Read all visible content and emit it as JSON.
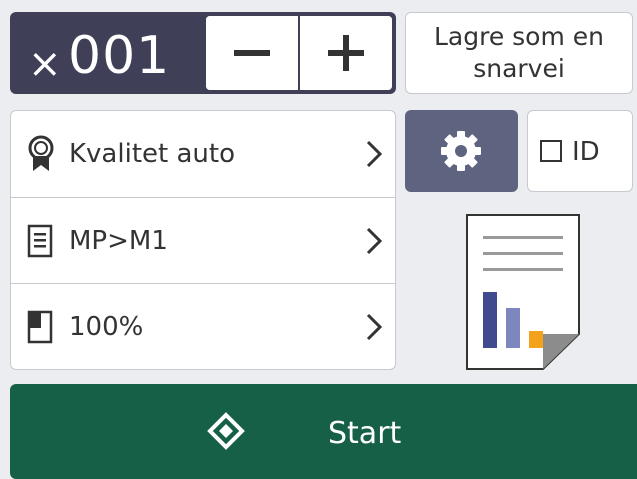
{
  "copies": {
    "prefix": "×",
    "count": "001",
    "minus_icon": "minus-icon",
    "plus_icon": "plus-icon"
  },
  "shortcut_button": {
    "line1": "Lagre som en",
    "line2": "snarvei"
  },
  "settings": {
    "items": [
      {
        "icon": "quality-ribbon-icon",
        "label": "Kvalitet auto"
      },
      {
        "icon": "tray-list-icon",
        "label": "MP>M1"
      },
      {
        "icon": "page-scale-icon",
        "label": "100%"
      }
    ]
  },
  "options_button": {
    "icon": "gear-icon"
  },
  "id_toggle": {
    "label": "ID",
    "checked": false
  },
  "preview": {
    "icon": "document-preview-icon"
  },
  "start_button": {
    "label": "Start",
    "icon": "start-diamond-icon"
  },
  "colors": {
    "header_bg": "#3f3f57",
    "gear_bg": "#5e647f",
    "start_bg": "#176048",
    "screen_bg": "#ecedf0"
  }
}
